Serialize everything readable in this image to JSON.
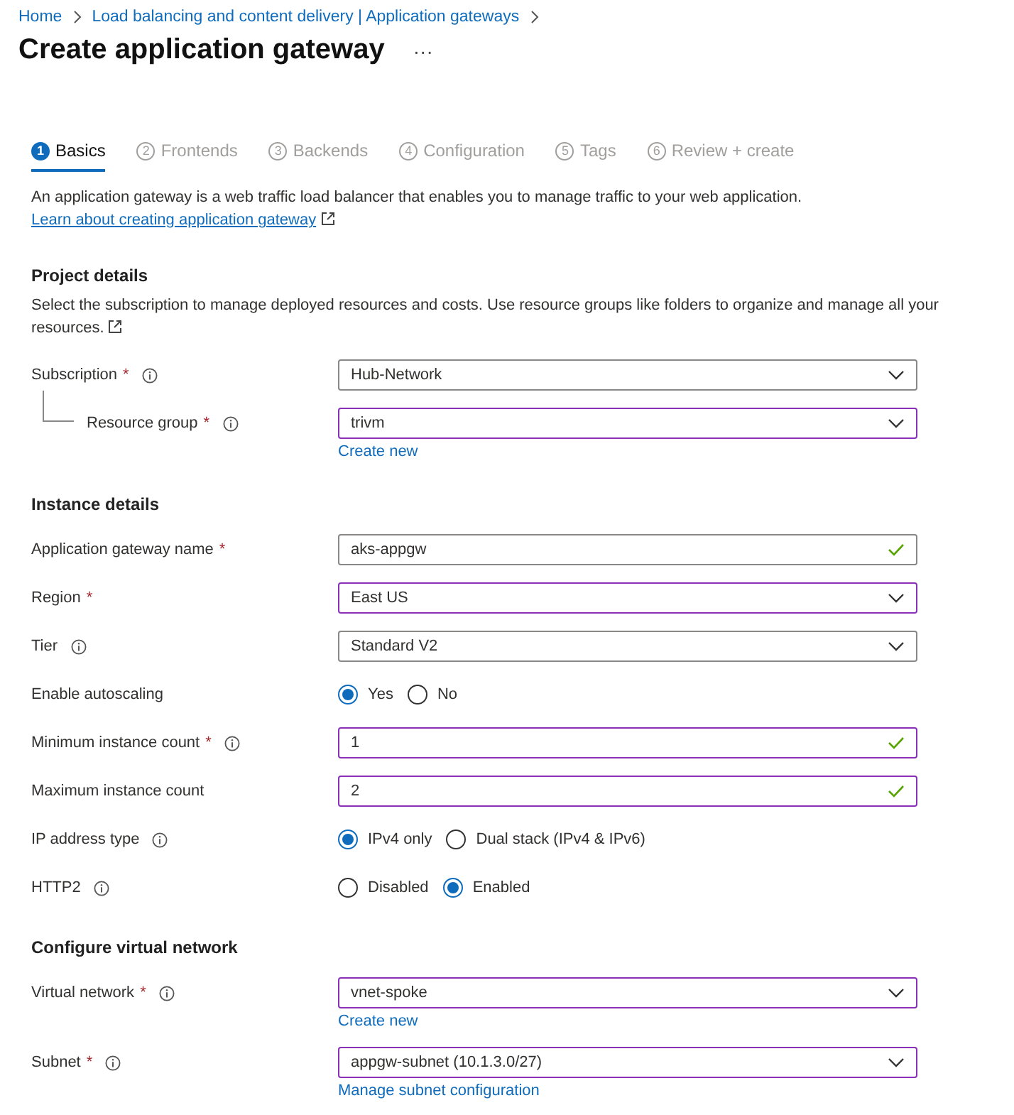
{
  "breadcrumb": [
    {
      "label": "Home"
    },
    {
      "label": "Load balancing and content delivery | Application gateways"
    }
  ],
  "title": "Create application gateway",
  "more": "···",
  "tabs": [
    {
      "number": "1",
      "label": "Basics",
      "selected": true
    },
    {
      "number": "2",
      "label": "Frontends",
      "selected": false
    },
    {
      "number": "3",
      "label": "Backends",
      "selected": false
    },
    {
      "number": "4",
      "label": "Configuration",
      "selected": false
    },
    {
      "number": "5",
      "label": "Tags",
      "selected": false
    },
    {
      "number": "6",
      "label": "Review + create",
      "selected": false
    }
  ],
  "intro": {
    "text": "An application gateway is a web traffic load balancer that enables you to manage traffic to your web application.",
    "link": "Learn about creating application gateway"
  },
  "sections": [
    {
      "heading": "Project details",
      "description": "Select the subscription to manage deployed resources and costs. Use resource groups like folders to organize and manage all your resources.",
      "description_link_icon": true,
      "rows": [
        {
          "label": "Subscription",
          "marker": "*",
          "info": true,
          "control": {
            "kind": "dropdown",
            "value": "Hub-Network",
            "highlighted": false
          }
        },
        {
          "label": "Resource group",
          "marker": "*",
          "info": true,
          "nested": true,
          "control": {
            "kind": "dropdown",
            "value": "trivm",
            "highlighted": true
          },
          "link": "Create new"
        }
      ]
    },
    {
      "heading": "Instance details",
      "rows": [
        {
          "label": "Application gateway name",
          "marker": "*",
          "control": {
            "kind": "text",
            "value": "aks-appgw",
            "highlighted": false,
            "valid": true
          }
        },
        {
          "label": "Region",
          "marker": "*",
          "control": {
            "kind": "dropdown",
            "value": "East US",
            "highlighted": true
          }
        },
        {
          "label": "Tier",
          "info": true,
          "control": {
            "kind": "dropdown",
            "value": "Standard V2",
            "highlighted": false
          }
        },
        {
          "label": "Enable autoscaling",
          "control": {
            "kind": "radio",
            "options": [
              {
                "label": "Yes",
                "selected": true
              },
              {
                "label": "No",
                "selected": false
              }
            ]
          }
        },
        {
          "label": "Minimum instance count",
          "marker": "*",
          "info": true,
          "control": {
            "kind": "text",
            "value": "1",
            "highlighted": true,
            "valid": true
          }
        },
        {
          "label": "Maximum instance count",
          "control": {
            "kind": "text",
            "value": "2",
            "highlighted": true,
            "valid": true
          }
        },
        {
          "label": "IP address type",
          "info": true,
          "control": {
            "kind": "radio",
            "options": [
              {
                "label": "IPv4 only",
                "selected": true
              },
              {
                "label": "Dual stack (IPv4 & IPv6)",
                "selected": false
              }
            ]
          }
        },
        {
          "label": "HTTP2",
          "info": true,
          "control": {
            "kind": "radio",
            "options": [
              {
                "label": "Disabled",
                "selected": false
              },
              {
                "label": "Enabled",
                "selected": true
              }
            ]
          }
        }
      ]
    },
    {
      "heading": "Configure virtual network",
      "rows": [
        {
          "label": "Virtual network",
          "marker": "*",
          "info": true,
          "control": {
            "kind": "dropdown",
            "value": "vnet-spoke",
            "highlighted": true
          },
          "link": "Create new"
        },
        {
          "label": "Subnet",
          "marker": "*",
          "info": true,
          "control": {
            "kind": "dropdown",
            "value": "appgw-subnet (10.1.3.0/27)",
            "highlighted": true
          },
          "link": "Manage subnet configuration"
        }
      ]
    }
  ]
}
